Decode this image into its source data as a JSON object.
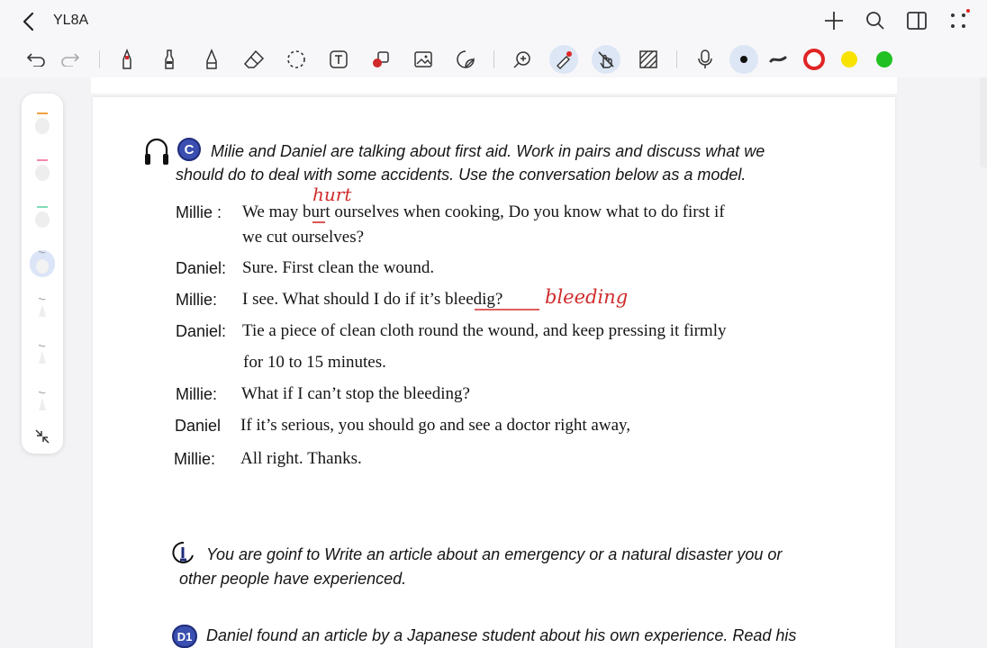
{
  "header": {
    "doc_title": "YL8A"
  },
  "icons": {
    "back": "chevron-left-icon",
    "add": "plus-icon",
    "search": "search-icon",
    "layout": "sidebar-layout-icon",
    "more": "grid-dots-icon"
  },
  "toolbar": {
    "pen_colors": [
      "#111111",
      "#333333",
      "#e02525",
      "#f7e200",
      "#22c022"
    ]
  },
  "document": {
    "section_c": {
      "badge": "C",
      "instruction_line1": "Milie and Daniel are talking about first aid. Work in pairs and discuss what we",
      "instruction_line2": "should do to deal with some accidents. Use the conversation below as a model.",
      "dialogue": [
        {
          "speaker": "Millie :",
          "line1": "We may burt ourselves when cooking, Do you know what to do first if",
          "line2": "we cut ourselves?"
        },
        {
          "speaker": "Daniel:",
          "line1": "Sure. First clean the wound."
        },
        {
          "speaker": "Millie:",
          "line1": "I see. What should I do if it’s bleedig?"
        },
        {
          "speaker": "Daniel:",
          "line1": "Tie a piece of clean cloth round the wound, and keep pressing it firmly",
          "line2": "for 10 to 15 minutes."
        },
        {
          "speaker": "Millie:",
          "line1": "What if I can’t stop the bleeding?"
        },
        {
          "speaker": "Daniel",
          "line1": "If it’s serious, you should go and see a doctor right away,"
        },
        {
          "speaker": "Millie:",
          "line1": "All right. Thanks."
        }
      ],
      "annotations": {
        "hurt": "hurt",
        "bleeding": "bleeding"
      }
    },
    "section_d": {
      "instruction_line1": "You are goinf to Write an article about an emergency or a natural disaster you or",
      "instruction_line2": "other people have experienced."
    },
    "section_d1": {
      "badge": "D1",
      "instruction_line1": "Daniel found an article by a Japanese student about his own experience. Read his"
    }
  }
}
